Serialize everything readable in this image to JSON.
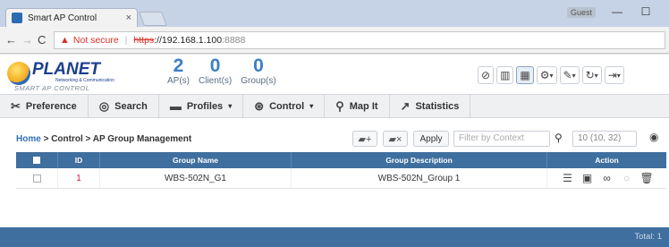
{
  "browser": {
    "tab_title": "Smart AP Control",
    "tab_close": "×",
    "user_badge": "Guest",
    "minimize": "—",
    "maximize": "☐",
    "back": "←",
    "forward": "→",
    "reload": "C",
    "not_secure": "Not secure",
    "url_scheme": "https",
    "url_host": "://192.168.1.100",
    "url_port": ":8888"
  },
  "brand": {
    "name": "PLANET",
    "subtitle": "Networking & Communication",
    "tagline": "SMART AP CONTROL"
  },
  "counters": [
    {
      "value": "2",
      "label": "AP(s)"
    },
    {
      "value": "0",
      "label": "Client(s)"
    },
    {
      "value": "0",
      "label": "Group(s)"
    }
  ],
  "menu": {
    "preference": "Preference",
    "search": "Search",
    "profiles": "Profiles",
    "control": "Control",
    "map_it": "Map It",
    "statistics": "Statistics"
  },
  "breadcrumb": {
    "home": "Home",
    "path": " > Control > AP Group Management"
  },
  "toolbar": {
    "apply": "Apply",
    "filter_placeholder": "Filter by Context",
    "paging": "10 (10, 32)"
  },
  "table": {
    "headers": {
      "id": "ID",
      "group_name": "Group Name",
      "group_description": "Group Description",
      "action": "Action"
    },
    "rows": [
      {
        "id": "1",
        "group_name": "WBS-502N_G1",
        "group_description": "WBS-502N_Group 1"
      }
    ]
  },
  "footer": {
    "total": "Total: 1"
  },
  "colors": {
    "accent": "#3f6f9e",
    "counter": "#3c7fc4",
    "warning": "#d93025"
  }
}
